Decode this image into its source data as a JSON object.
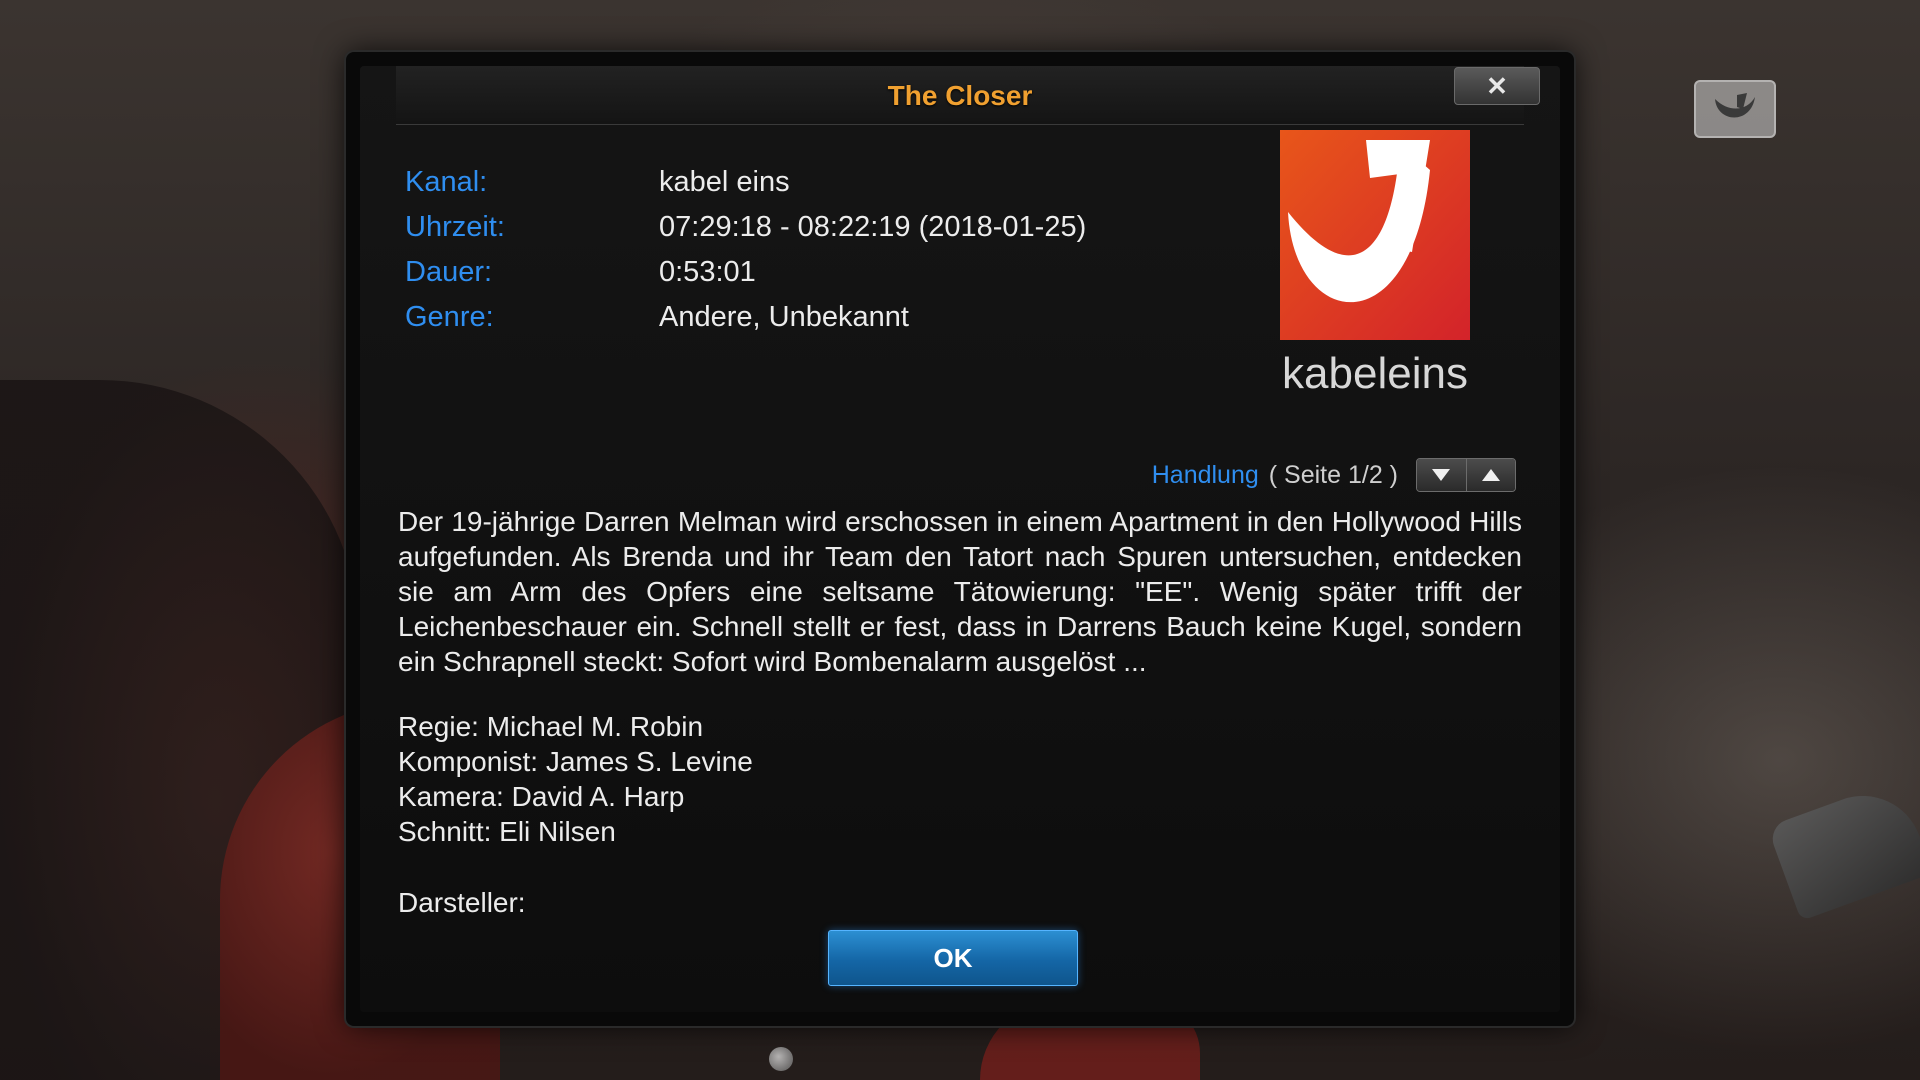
{
  "dialog": {
    "title": "The Closer",
    "close_label": "✕"
  },
  "info": {
    "kanal": {
      "label": "Kanal:",
      "value": "kabel eins"
    },
    "uhrzeit": {
      "label": "Uhrzeit:",
      "value": "07:29:18 - 08:22:19 (2018-01-25)"
    },
    "dauer": {
      "label": "Dauer:",
      "value": "0:53:01"
    },
    "genre": {
      "label": "Genre:",
      "value": "Andere, Unbekannt"
    }
  },
  "logo": {
    "text": "kabeleins",
    "icon": "kabel-eins-logo",
    "colors": {
      "orange": "#e8561a",
      "red": "#d3232a",
      "white": "#ffffff"
    }
  },
  "plot": {
    "heading": "Handlung",
    "page": "( Seite 1/2 )",
    "text": "Der 19-jährige Darren Melman wird erschossen in einem Apartment in den Hollywood Hills aufgefunden. Als Brenda und ihr Team den Tatort nach Spuren untersuchen, entdecken sie am Arm des Opfers eine seltsame Tätowierung: \"EE\". Wenig später trifft der Leichenbeschauer ein. Schnell stellt er fest, dass in Darrens Bauch keine Kugel, sondern ein Schrapnell steckt: Sofort wird Bombenalarm ausgelöst ...",
    "credits": [
      "Regie: Michael M. Robin",
      "Komponist: James S. Levine",
      "Kamera: David A. Harp",
      "Schnitt: Eli Nilsen"
    ],
    "darsteller": "Darsteller:"
  },
  "buttons": {
    "ok": "OK",
    "page_down_icon": "triangle-down-icon",
    "page_up_icon": "triangle-up-icon"
  },
  "colors": {
    "title": "#f0a030",
    "label": "#2f8ef0",
    "text": "#ececec",
    "ok_button": "#1466a6"
  }
}
